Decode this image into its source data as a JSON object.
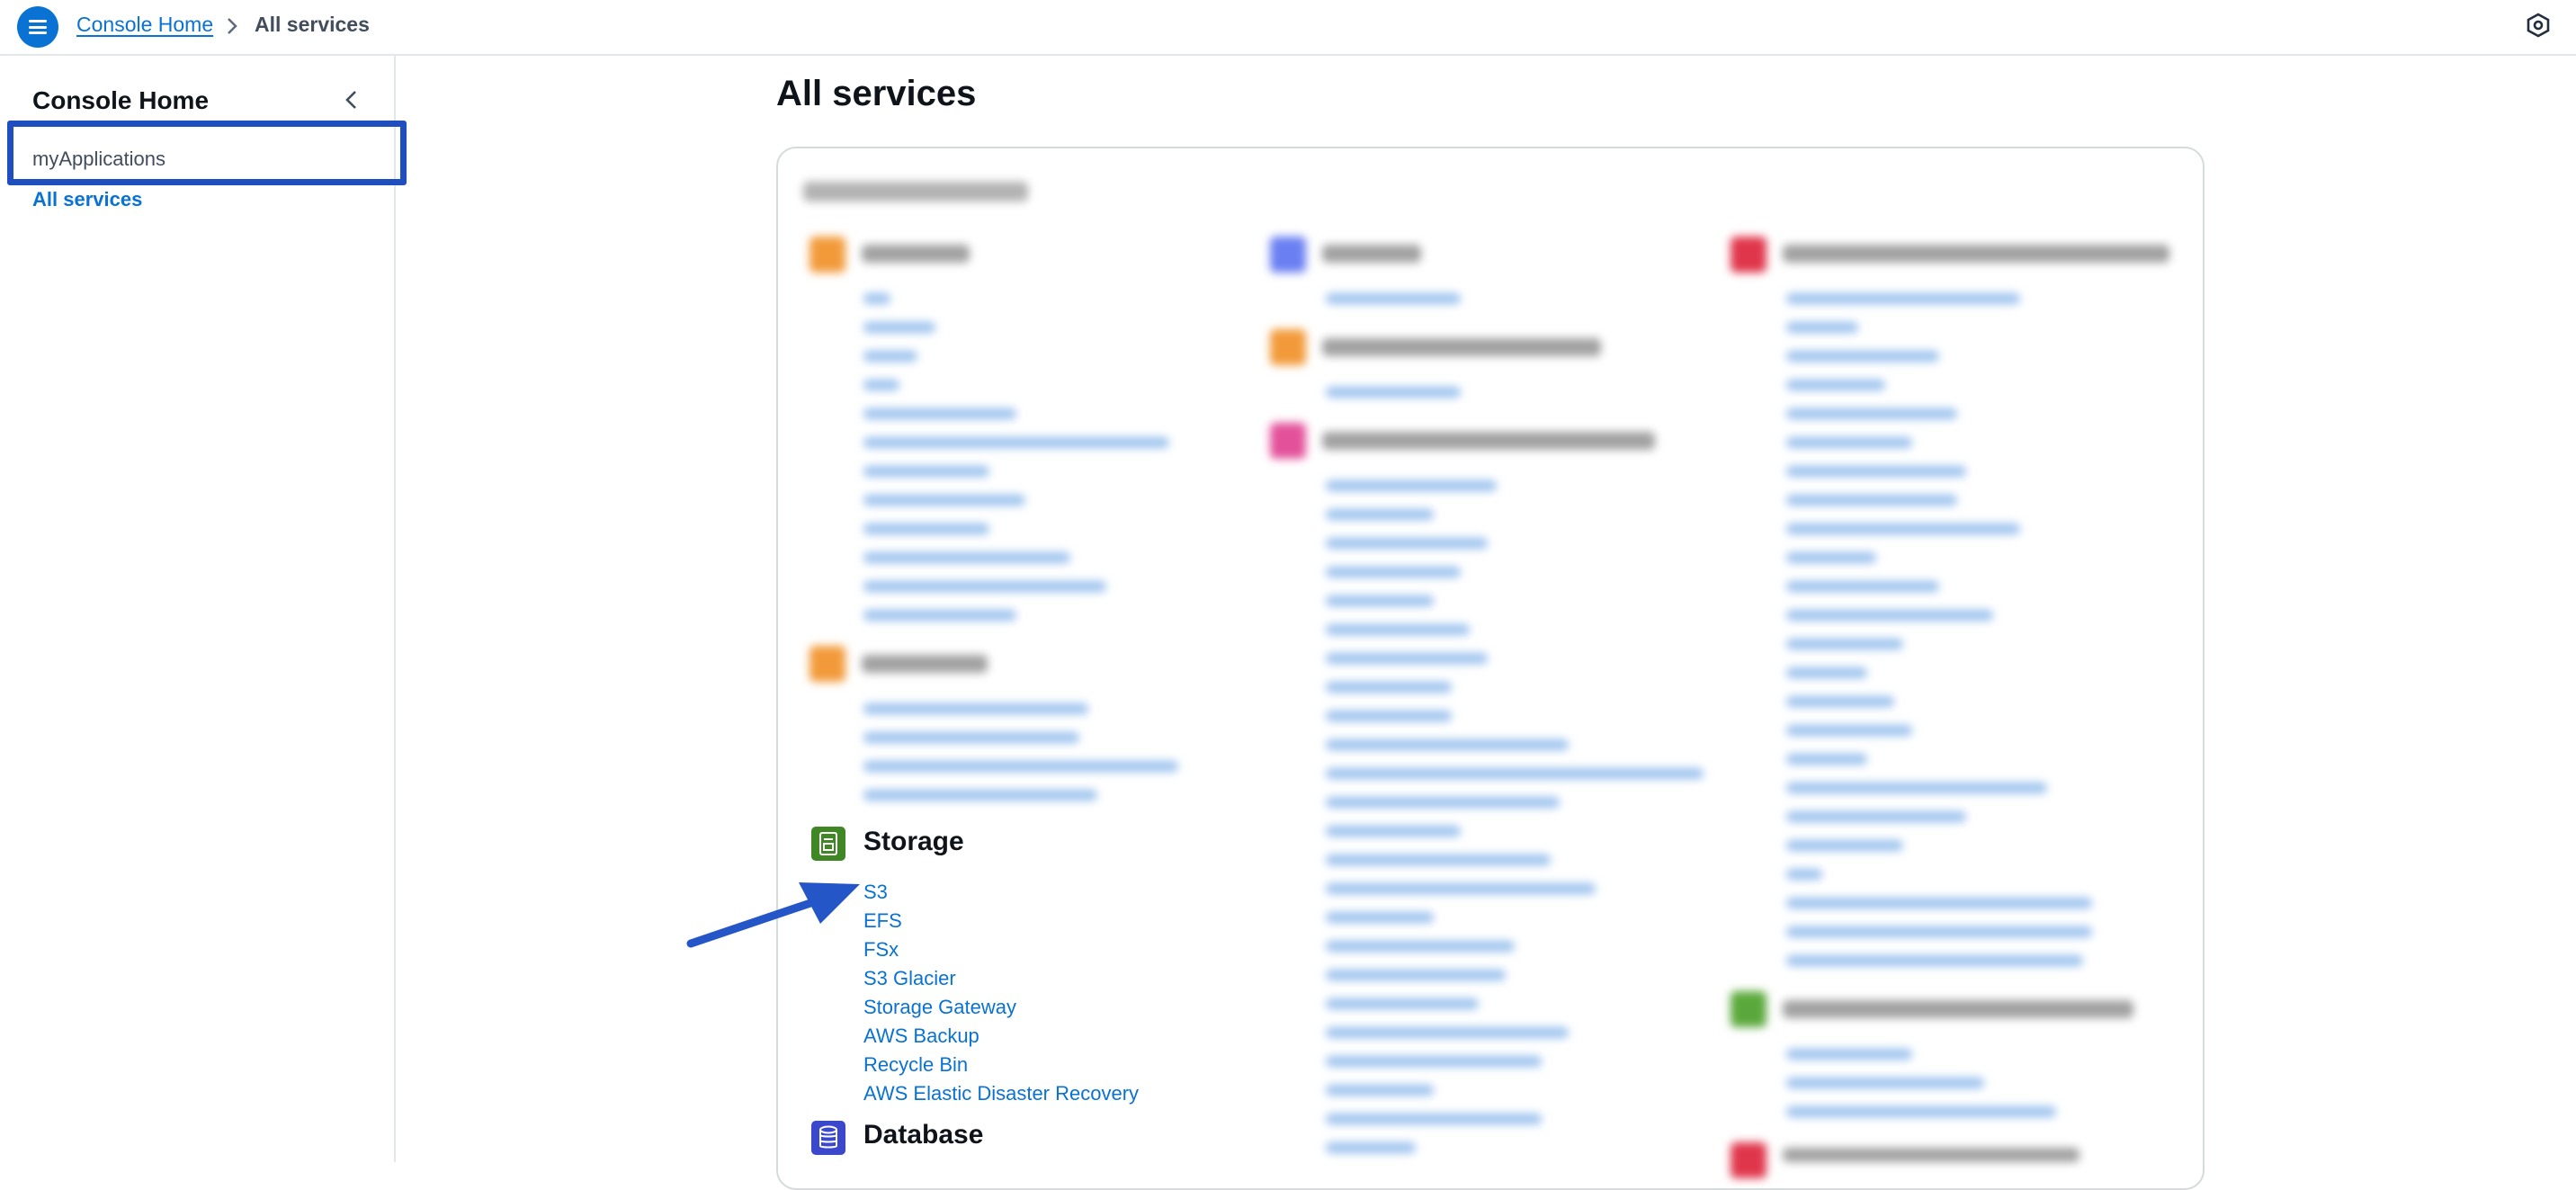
{
  "topbar": {
    "menu_icon": "hamburger-menu-icon",
    "breadcrumb": {
      "home": "Console Home",
      "current": "All services"
    },
    "settings_icon": "cloud-settings-icon"
  },
  "sidebar": {
    "title": "Console Home",
    "collapse_icon": "chevron-left-icon",
    "items": [
      {
        "label": "myApplications"
      },
      {
        "label": "All services",
        "active": true
      }
    ]
  },
  "main": {
    "title": "All services",
    "storage": {
      "title": "Storage",
      "icon": "storage-icon",
      "links": [
        "S3",
        "EFS",
        "FSx",
        "S3 Glacier",
        "Storage Gateway",
        "AWS Backup",
        "Recycle Bin",
        "AWS Elastic Disaster Recovery"
      ]
    },
    "database": {
      "title": "Database",
      "icon": "database-icon"
    }
  },
  "annotations": {
    "highlight_color": "#1f4fbf",
    "arrow_color": "#2556c8"
  },
  "colors": {
    "link": "#0972d3",
    "storage": "#3f8624",
    "database": "#3b48cc"
  }
}
